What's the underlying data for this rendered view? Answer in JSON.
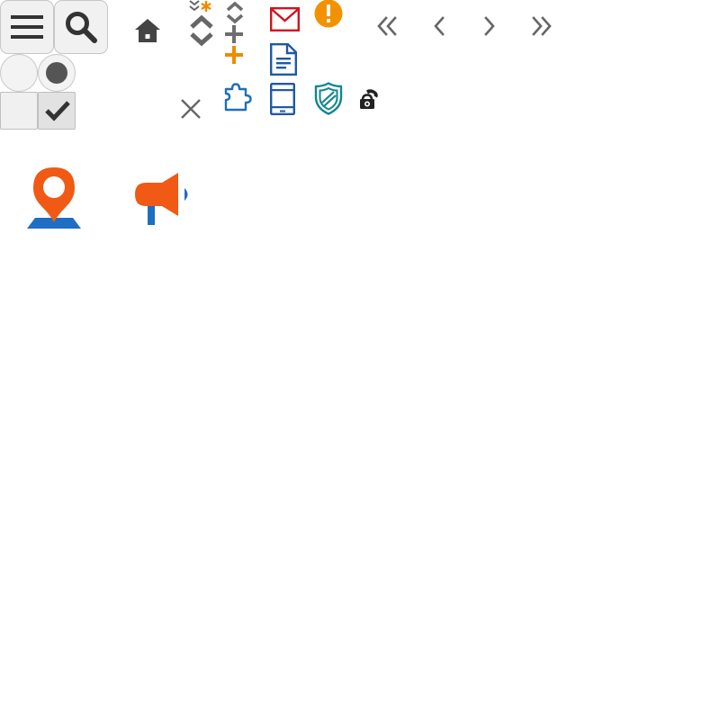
{
  "toolbar": {
    "menu_icon": "hamburger-menu-icon",
    "search_icon": "search-icon",
    "home_icon": "home-icon"
  },
  "controls": {
    "radio_unselected": "radio-unselected",
    "radio_selected": "radio-selected",
    "checkbox_unchecked": "checkbox-unchecked",
    "checkbox_checked": "checkbox-checked",
    "close_icon": "close-icon"
  },
  "sort_and_add": {
    "sort_required_icon": "sort-required-icon",
    "sort_icon": "sort-icon",
    "sort_small_icon": "sort-small-icon",
    "add_gray_icon": "add-gray-icon",
    "add_orange_icon": "add-orange-icon"
  },
  "status_icons": {
    "mail_icon": "mail-icon",
    "alert_icon": "alert-icon",
    "document_icon": "document-icon",
    "puzzle_icon": "puzzle-icon",
    "mobile_icon": "mobile-device-icon",
    "shield_icon": "shield-icon",
    "phone_lock_icon": "phone-lock-icon"
  },
  "pagination": {
    "first_icon": "double-chevron-left-icon",
    "prev_icon": "chevron-left-icon",
    "next_icon": "chevron-right-icon",
    "last_icon": "double-chevron-right-icon"
  },
  "illustrations": {
    "location_pin": "location-pin-icon",
    "megaphone": "megaphone-icon"
  },
  "colors": {
    "gray_icon": "#333333",
    "mid_gray": "#6e6e6e",
    "orange": "#f08a00",
    "red": "#d0141e",
    "blue": "#1f5aa0",
    "teal": "#13858f",
    "pin_orange": "#f05a14",
    "pin_blue": "#1e6ec3"
  }
}
